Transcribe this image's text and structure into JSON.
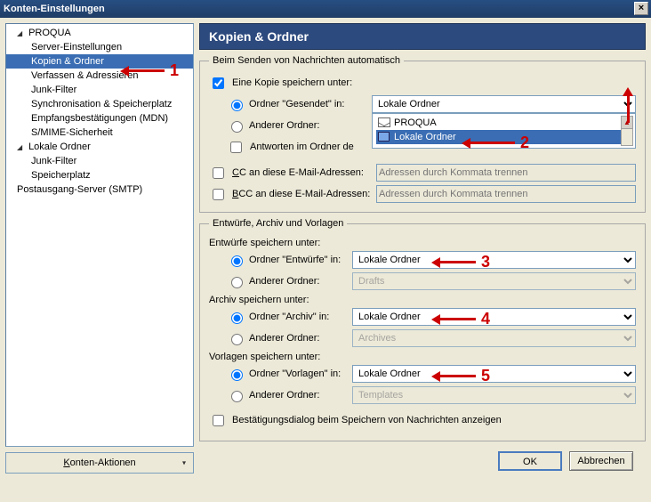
{
  "window": {
    "title": "Konten-Einstellungen",
    "close_glyph": "×"
  },
  "sidebar": {
    "accounts": [
      {
        "name": "PROQUA",
        "items": [
          "Server-Einstellungen",
          "Kopien & Ordner",
          "Verfassen & Adressieren",
          "Junk-Filter",
          "Synchronisation & Speicherplatz",
          "Empfangsbestätigungen (MDN)",
          "S/MIME-Sicherheit"
        ],
        "selected_index": 1
      },
      {
        "name": "Lokale Ordner",
        "items": [
          "Junk-Filter",
          "Speicherplatz"
        ]
      }
    ],
    "extra_items": [
      "Postausgang-Server (SMTP)"
    ],
    "actions_button": "Konten-Aktionen"
  },
  "page": {
    "heading": "Kopien & Ordner",
    "send_group": {
      "legend": "Beim Senden von Nachrichten automatisch",
      "copy_checkbox": "Eine Kopie speichern unter:",
      "sent_radio": "Ordner \"Gesendet\" in:",
      "sent_select_value": "Lokale Ordner",
      "folder_popup": {
        "items": [
          "PROQUA",
          "Lokale Ordner"
        ],
        "selected_index": 1
      },
      "other_radio": "Anderer Ordner:",
      "reply_folder_check": "Antworten im Ordner de",
      "cc_label": "CC an diese E-Mail-Adressen:",
      "bcc_label": "BCC an diese E-Mail-Adressen:",
      "addr_placeholder": "Adressen durch Kommata trennen"
    },
    "drafts_group": {
      "legend": "Entwürfe, Archiv und Vorlagen",
      "drafts_title": "Entwürfe speichern unter:",
      "drafts_radio": "Ordner \"Entwürfe\" in:",
      "drafts_value": "Lokale Ordner",
      "drafts_other": "Anderer Ordner:",
      "drafts_other_value": "Drafts",
      "archive_title": "Archiv speichern unter:",
      "archive_radio": "Ordner \"Archiv\" in:",
      "archive_value": "Lokale Ordner",
      "archive_other": "Anderer Ordner:",
      "archive_other_value": "Archives",
      "templates_title": "Vorlagen speichern unter:",
      "templates_radio": "Ordner \"Vorlagen\" in:",
      "templates_value": "Lokale Ordner",
      "templates_other": "Anderer Ordner:",
      "templates_other_value": "Templates",
      "confirm_check": "Bestätigungsdialog beim Speichern von Nachrichten anzeigen"
    }
  },
  "buttons": {
    "ok": "OK",
    "cancel": "Abbrechen"
  },
  "annotations": {
    "n1": "1",
    "n2": "2",
    "n3": "3",
    "n4": "4",
    "n5": "5"
  }
}
